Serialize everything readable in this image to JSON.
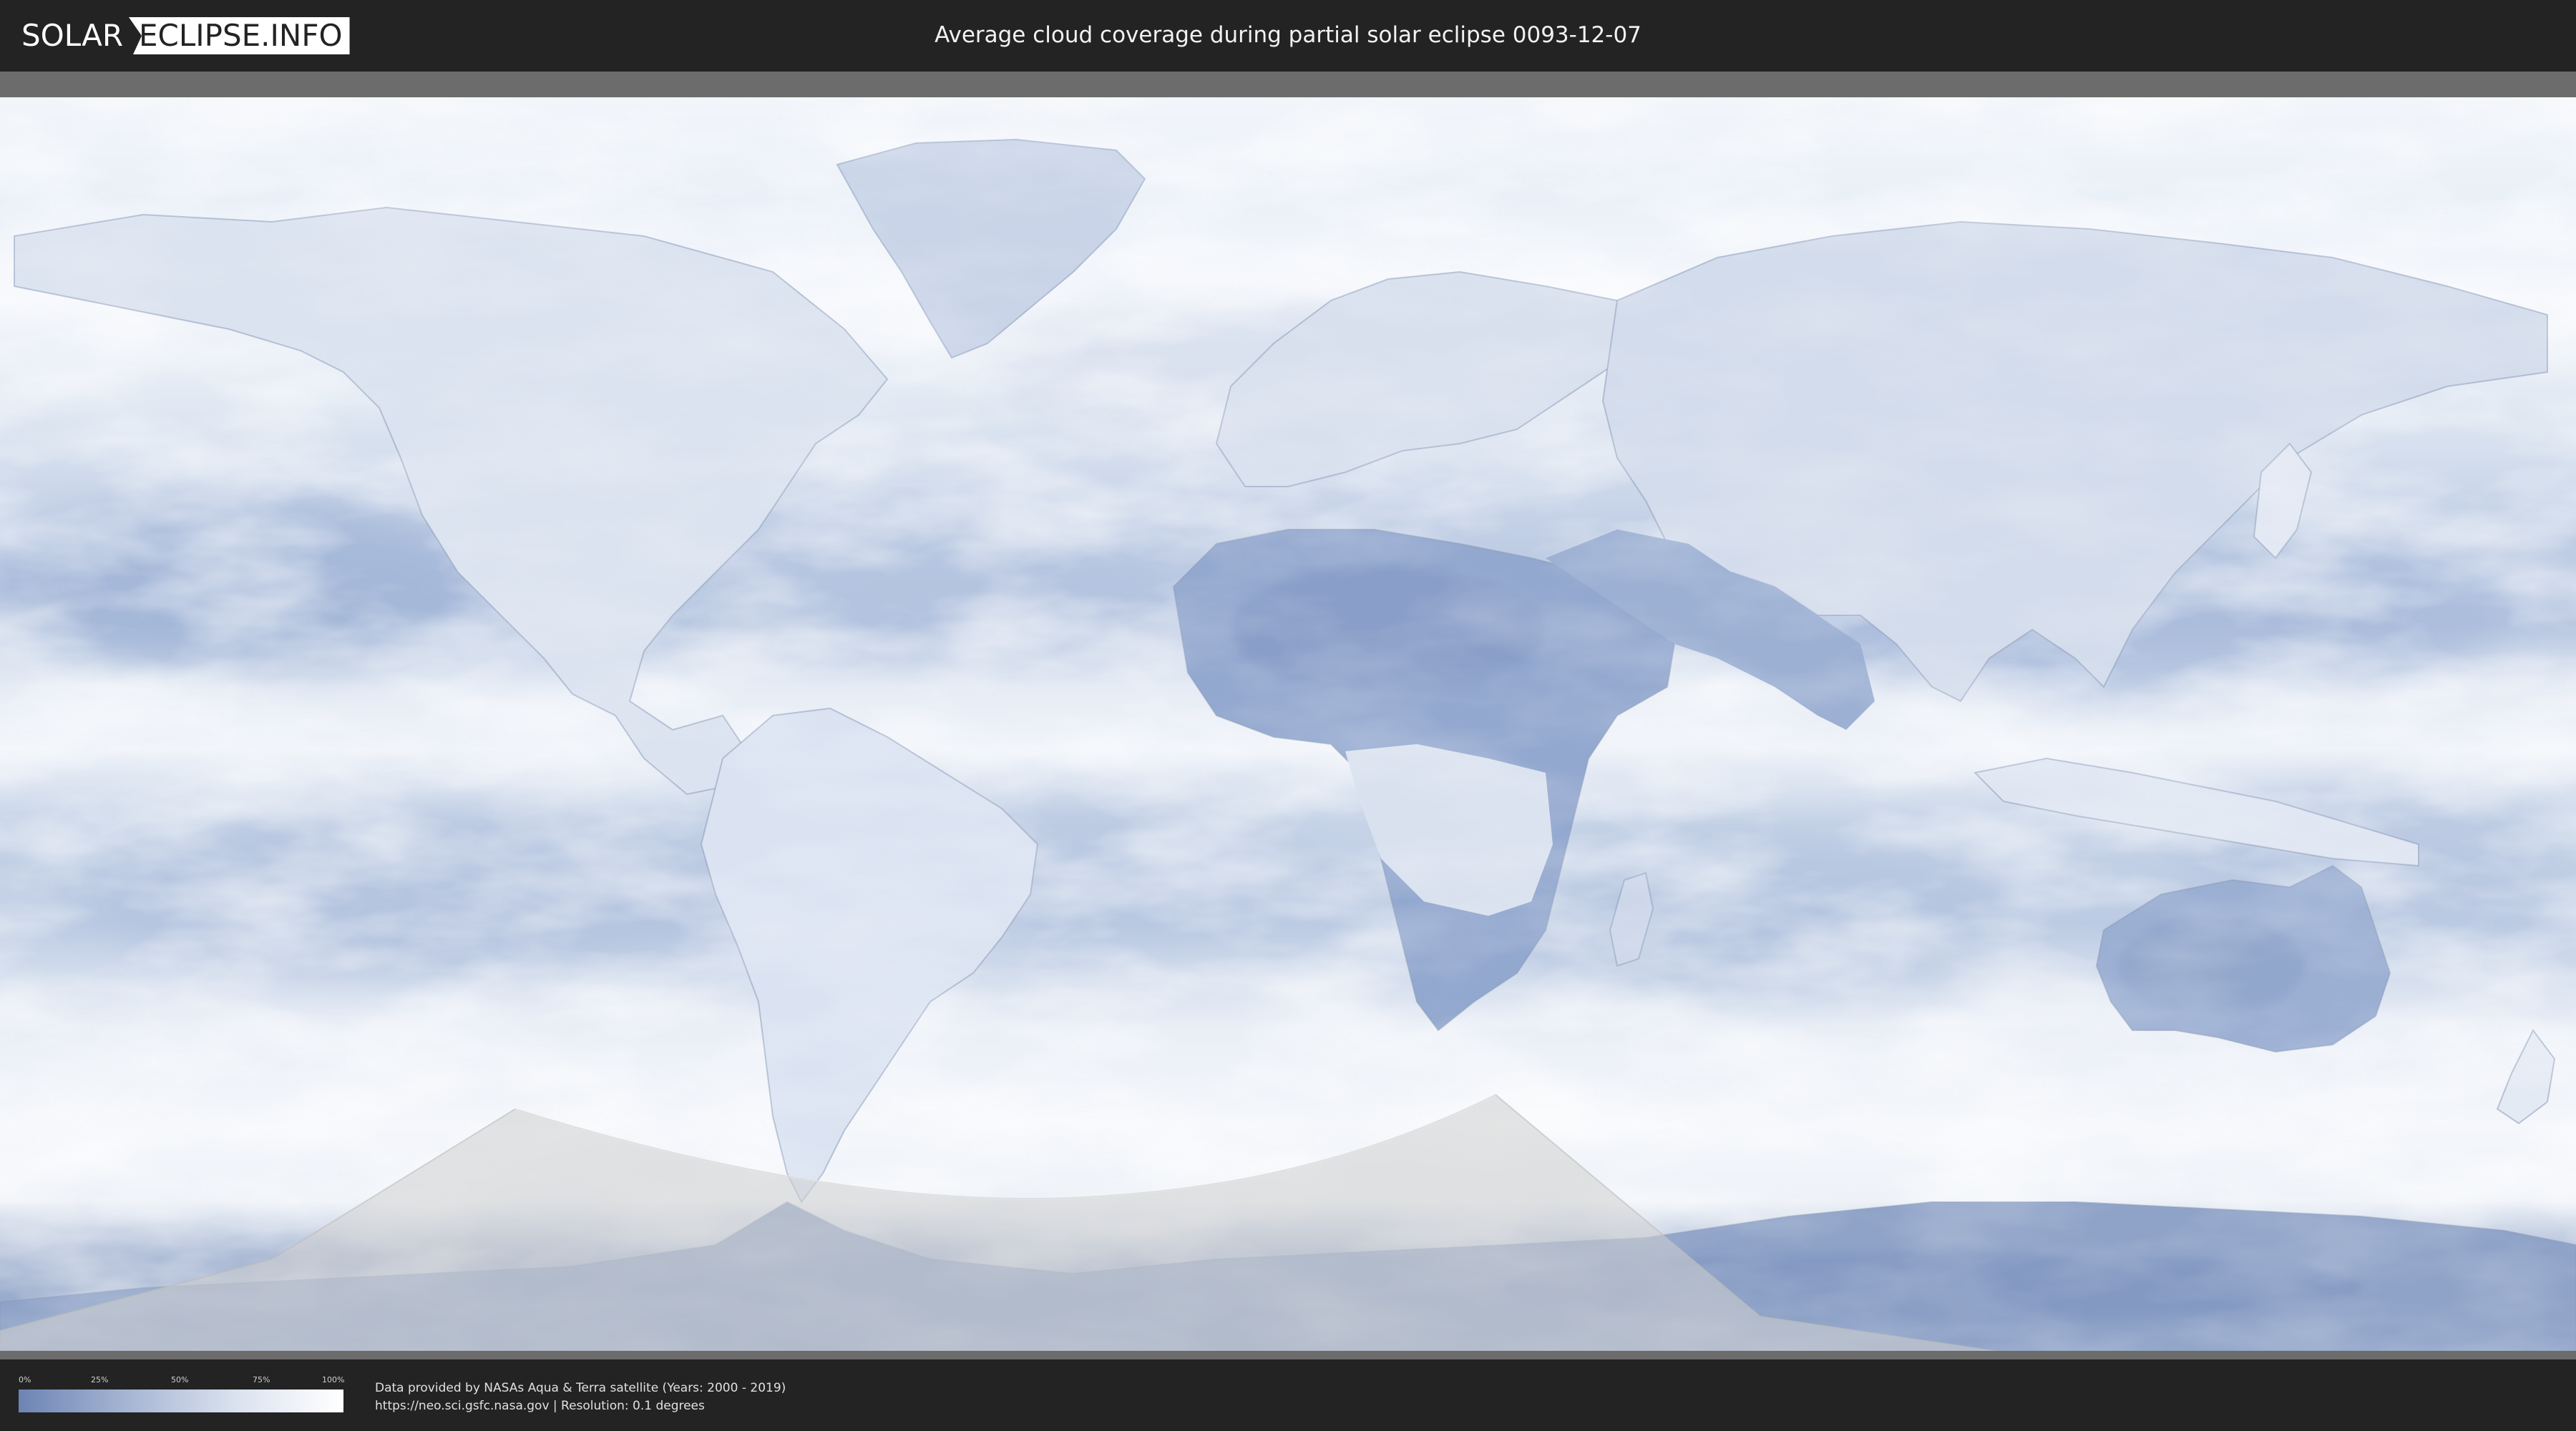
{
  "header": {
    "logo_solar": "SOLAR",
    "logo_eclipse": "ECLIPSE.INFO",
    "title": "Average cloud coverage during partial solar eclipse 0093-12-07"
  },
  "map": {
    "projection": "equirectangular",
    "colors": {
      "cloud_clear": "#6d84b4",
      "cloud_full": "#ffffff",
      "eclipse_overlay": "#d6d6d6"
    }
  },
  "legend": {
    "ticks": [
      "0%",
      "25%",
      "50%",
      "75%",
      "100%"
    ],
    "colors": [
      "#6d84b4",
      "#a5b5d3",
      "#dbe2ef",
      "#ffffff"
    ]
  },
  "credits": {
    "line1": "Data provided by NASAs Aqua & Terra satellite (Years: 2000 - 2019)",
    "line2": "https://neo.sci.gsfc.nasa.gov | Resolution: 0.1 degrees"
  }
}
